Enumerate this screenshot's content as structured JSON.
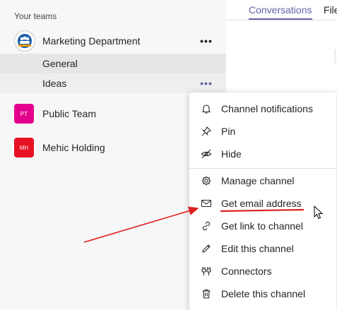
{
  "sidebar": {
    "section_title": "Your teams",
    "teams": [
      {
        "name": "Marketing Department",
        "more": "•••",
        "channels": [
          {
            "name": "General",
            "state": "selected"
          },
          {
            "name": "Ideas",
            "state": "hovered",
            "more": "•••"
          }
        ]
      },
      {
        "name": "Public Team",
        "initials": "PT",
        "color": "#e3008c"
      },
      {
        "name": "Mehic Holding",
        "initials": "MH",
        "color": "#e81123"
      }
    ]
  },
  "tabs": [
    {
      "label": "Conversations",
      "active": true
    },
    {
      "label": "Files",
      "active": false
    }
  ],
  "context_menu": {
    "items": [
      {
        "label": "Channel notifications",
        "icon": "bell-icon"
      },
      {
        "label": "Pin",
        "icon": "pin-icon"
      },
      {
        "label": "Hide",
        "icon": "eye-off-icon"
      },
      {
        "label": "Manage channel",
        "icon": "gear-icon"
      },
      {
        "label": "Get email address",
        "icon": "envelope-icon",
        "highlighted": true
      },
      {
        "label": "Get link to channel",
        "icon": "link-icon"
      },
      {
        "label": "Edit this channel",
        "icon": "pencil-icon"
      },
      {
        "label": "Connectors",
        "icon": "plug-icon"
      },
      {
        "label": "Delete this channel",
        "icon": "trash-icon"
      }
    ]
  },
  "colors": {
    "accent": "#6264a7",
    "annotation_red": "#e02020"
  }
}
